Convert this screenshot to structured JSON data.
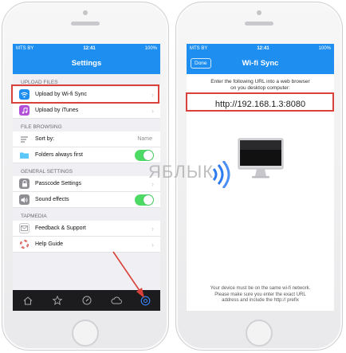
{
  "left_phone": {
    "status": {
      "carrier": "MTS BY",
      "time": "12:41",
      "battery": "100%"
    },
    "title": "Settings",
    "sections": [
      {
        "header": "UPLOAD FILES",
        "rows": [
          {
            "label": "Upload by Wi-fi Sync",
            "icon": "wifi-icon",
            "icon_color": "#1e8ff0",
            "accessory": "chevron",
            "highlighted": true
          },
          {
            "label": "Upload by iTunes",
            "icon": "music-note-icon",
            "icon_color": "#b350d8",
            "accessory": "chevron"
          }
        ]
      },
      {
        "header": "FILE BROWSING",
        "rows": [
          {
            "label": "Sort by:",
            "icon": "sort-lines-icon",
            "icon_color": "#8e8e93",
            "accessory": "value",
            "value": "Name"
          },
          {
            "label": "Folders always first",
            "icon": "folder-icon",
            "icon_color": "#5ac8fa",
            "accessory": "toggle",
            "toggle_on": true
          }
        ]
      },
      {
        "header": "GENERAL SETTINGS",
        "rows": [
          {
            "label": "Passcode Settings",
            "icon": "lock-icon",
            "icon_color": "#8e8e93",
            "accessory": "chevron"
          },
          {
            "label": "Sound effects",
            "icon": "speaker-icon",
            "icon_color": "#8e8e93",
            "accessory": "toggle",
            "toggle_on": true
          }
        ]
      },
      {
        "header": "TAPMEDIA",
        "rows": [
          {
            "label": "Feedback & Support",
            "icon": "envelope-icon",
            "icon_color": "#8e8e93",
            "accessory": "chevron"
          },
          {
            "label": "Help Guide",
            "icon": "help-lifebuoy-icon",
            "icon_color": "#d9423a",
            "accessory": "chevron"
          }
        ]
      }
    ],
    "tabbar": [
      "home-icon",
      "star-icon",
      "compass-icon",
      "cloud-icon",
      "settings-icon"
    ]
  },
  "right_phone": {
    "status": {
      "carrier": "MTS BY",
      "time": "12:41",
      "battery": "100%"
    },
    "done_label": "Done",
    "title": "Wi-fi Sync",
    "instructions_line1": "Enter the following URL into a web browser",
    "instructions_line2": "on you desktop computer:",
    "url": "http://192.168.1.3:8080",
    "footnote_line1": "Your device must be on the same wi-fi network.",
    "footnote_line2": "Please make sure you enter the exact URL",
    "footnote_line3": "address and include the http:// prefix"
  },
  "watermark": "ЯБЛЫК",
  "colors": {
    "accent": "#1e8ff0",
    "highlight": "#d9423a",
    "toggle_on": "#4cd964"
  }
}
